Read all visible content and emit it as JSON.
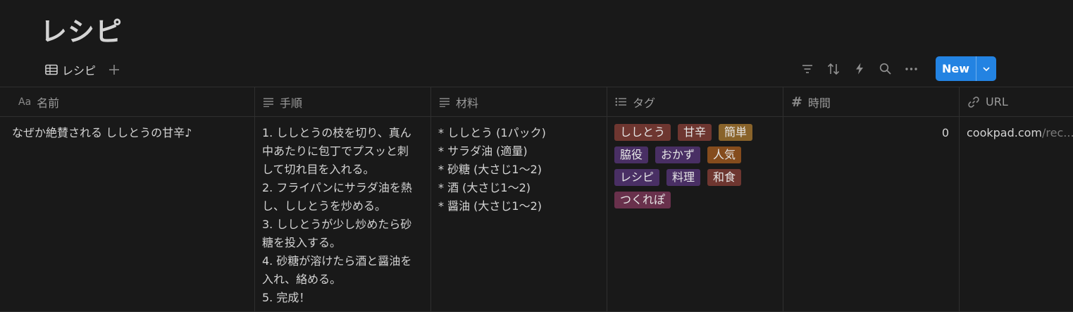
{
  "page": {
    "title": "レシピ"
  },
  "view": {
    "tab_label": "レシピ",
    "add_view_icon": "plus-icon"
  },
  "toolbar": {
    "icons": [
      "filter-icon",
      "sort-icon",
      "automation-icon",
      "search-icon",
      "more-icon"
    ],
    "new_label": "New",
    "accent": "#2383e2"
  },
  "columns": [
    {
      "icon": "Aa",
      "label": "名前"
    },
    {
      "icon": "text-icon",
      "label": "手順"
    },
    {
      "icon": "text-icon",
      "label": "材料"
    },
    {
      "icon": "list-icon",
      "label": "タグ"
    },
    {
      "icon": "#",
      "label": "時間"
    },
    {
      "icon": "link-icon",
      "label": "URL"
    }
  ],
  "rows": [
    {
      "name": "なぜか絶賛される ししとうの甘辛♪",
      "steps": [
        "1. ししとうの枝を切り、真ん",
        "中あたりに包丁でプスッと刺",
        "して切れ目を入れる。",
        "2. フライパンにサラダ油を熱",
        "し、ししとうを炒める。",
        "3. ししとうが少し炒めたら砂",
        "糖を投入する。",
        "4. 砂糖が溶けたら酒と醤油を",
        "入れ、絡める。",
        "5. 完成！"
      ],
      "ingredients": [
        "* ししとう (1パック)",
        "* サラダ油 (適量)",
        "* 砂糖 (大さじ1〜2)",
        "* 酒 (大さじ1〜2)",
        "* 醤油 (大さじ1〜2)"
      ],
      "tags": [
        {
          "label": "ししとう",
          "color": "#6e3630"
        },
        {
          "label": "甘辛",
          "color": "#6e3630"
        },
        {
          "label": "簡単",
          "color": "#89632a"
        },
        {
          "label": "脇役",
          "color": "#492f64"
        },
        {
          "label": "おかず",
          "color": "#492f64"
        },
        {
          "label": "人気",
          "color": "#854c1d"
        },
        {
          "label": "レシピ",
          "color": "#492f64"
        },
        {
          "label": "料理",
          "color": "#492f64"
        },
        {
          "label": "和食",
          "color": "#6e3630"
        },
        {
          "label": "つくれぽ",
          "color": "#69314c"
        }
      ],
      "time": "0",
      "url_domain": "cookpad.com",
      "url_path": "/rec..."
    }
  ]
}
